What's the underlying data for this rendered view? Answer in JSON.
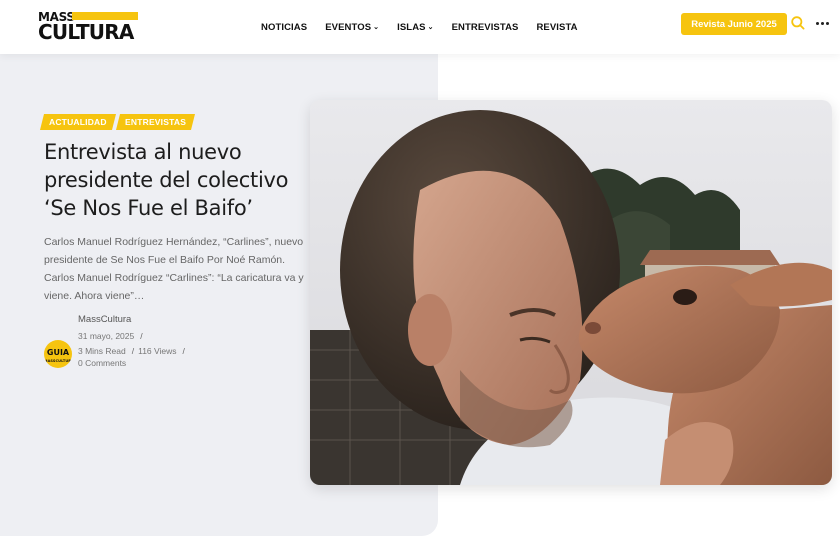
{
  "header": {
    "logo_top": "MASS",
    "logo_bottom": "CULTURA",
    "nav": [
      {
        "label": "NOTICIAS",
        "has_dropdown": false
      },
      {
        "label": "EVENTOS",
        "has_dropdown": true
      },
      {
        "label": "ISLAS",
        "has_dropdown": true
      },
      {
        "label": "ENTREVISTAS",
        "has_dropdown": false
      },
      {
        "label": "REVISTA",
        "has_dropdown": false
      }
    ],
    "cta_label": "Revista Junio 2025",
    "search_icon": "search-icon",
    "menu_icon": "more-dots-icon"
  },
  "article": {
    "tags": [
      "ACTUALIDAD",
      "ENTREVISTAS"
    ],
    "title": "Entrevista al nuevo presidente del colectivo ‘Se Nos Fue el Baifo’",
    "excerpt": "Carlos Manuel Rodríguez Hernández, “Carlines”, nuevo presidente de Se Nos Fue el Baifo Por Noé Ramón. Carlos Manuel Rodríguez “Carlines”: “La caricatura va y viene. Ahora viene”…",
    "author": "MassCultura",
    "date": "31 mayo, 2025",
    "read_time": "3 Mins Read",
    "views": "116 Views",
    "comments": "0 Comments",
    "avatar_text": "GUIA",
    "avatar_sub": "MASSCULTURA",
    "image_alt": "man-with-baby-goat-photo"
  },
  "colors": {
    "accent": "#f6c40f",
    "panel_bg": "#eeeff3",
    "text_dark": "#1d1d1d",
    "text_muted": "#666666"
  }
}
